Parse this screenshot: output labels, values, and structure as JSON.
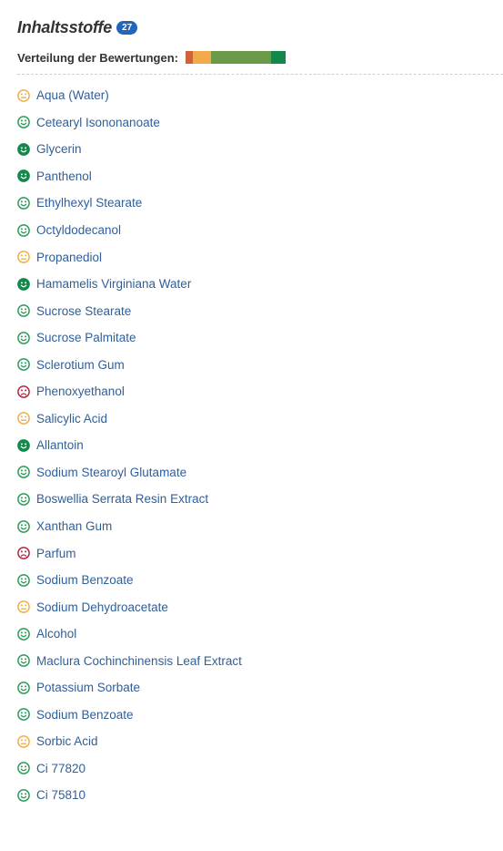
{
  "header": {
    "title": "Inhaltsstoffe",
    "count": "27"
  },
  "distribution": {
    "label": "Verteilung der Bewertungen:",
    "segments": [
      {
        "rating": "bad",
        "color": "#d0623c",
        "fraction": 0.074
      },
      {
        "rating": "moderate",
        "color": "#f0aa4a",
        "fraction": 0.185
      },
      {
        "rating": "good",
        "color": "#6a9a46",
        "fraction": 0.593
      },
      {
        "rating": "very-good",
        "color": "#12894a",
        "fraction": 0.148
      }
    ]
  },
  "colors": {
    "bad": "#b5253a",
    "moderate": "#ecb04a",
    "good": "#2e9a5a",
    "very-good": "#12894a"
  },
  "ingredients": [
    {
      "name": "Aqua (Water)",
      "rating": "moderate",
      "icon": "neutral-face-icon"
    },
    {
      "name": "Cetearyl Isononanoate",
      "rating": "good",
      "icon": "smiley-face-icon"
    },
    {
      "name": "Glycerin",
      "rating": "very-good",
      "icon": "smiley-face-filled-icon"
    },
    {
      "name": "Panthenol",
      "rating": "very-good",
      "icon": "smiley-face-filled-icon"
    },
    {
      "name": "Ethylhexyl Stearate",
      "rating": "good",
      "icon": "smiley-face-icon"
    },
    {
      "name": "Octyldodecanol",
      "rating": "good",
      "icon": "smiley-face-icon"
    },
    {
      "name": "Propanediol",
      "rating": "moderate",
      "icon": "neutral-face-icon"
    },
    {
      "name": "Hamamelis Virginiana Water",
      "rating": "very-good",
      "icon": "smiley-face-filled-icon"
    },
    {
      "name": "Sucrose Stearate",
      "rating": "good",
      "icon": "smiley-face-icon"
    },
    {
      "name": "Sucrose Palmitate",
      "rating": "good",
      "icon": "smiley-face-icon"
    },
    {
      "name": "Sclerotium Gum",
      "rating": "good",
      "icon": "smiley-face-icon"
    },
    {
      "name": "Phenoxyethanol",
      "rating": "bad",
      "icon": "sad-face-icon"
    },
    {
      "name": "Salicylic Acid",
      "rating": "moderate",
      "icon": "neutral-face-icon"
    },
    {
      "name": "Allantoin",
      "rating": "very-good",
      "icon": "smiley-face-filled-icon"
    },
    {
      "name": "Sodium Stearoyl Glutamate",
      "rating": "good",
      "icon": "smiley-face-icon"
    },
    {
      "name": "Boswellia Serrata Resin Extract",
      "rating": "good",
      "icon": "smiley-face-icon"
    },
    {
      "name": "Xanthan Gum",
      "rating": "good",
      "icon": "smiley-face-icon"
    },
    {
      "name": "Parfum",
      "rating": "bad",
      "icon": "sad-face-icon"
    },
    {
      "name": "Sodium Benzoate",
      "rating": "good",
      "icon": "smiley-face-icon"
    },
    {
      "name": "Sodium Dehydroacetate",
      "rating": "moderate",
      "icon": "neutral-face-icon"
    },
    {
      "name": "Alcohol",
      "rating": "good",
      "icon": "smiley-face-icon"
    },
    {
      "name": "Maclura Cochinchinensis Leaf Extract",
      "rating": "good",
      "icon": "smiley-face-icon"
    },
    {
      "name": "Potassium Sorbate",
      "rating": "good",
      "icon": "smiley-face-icon"
    },
    {
      "name": "Sodium Benzoate",
      "rating": "good",
      "icon": "smiley-face-icon"
    },
    {
      "name": "Sorbic Acid",
      "rating": "moderate",
      "icon": "neutral-face-icon"
    },
    {
      "name": "Ci 77820",
      "rating": "good",
      "icon": "smiley-face-icon"
    },
    {
      "name": "Ci 75810",
      "rating": "good",
      "icon": "smiley-face-icon"
    }
  ]
}
